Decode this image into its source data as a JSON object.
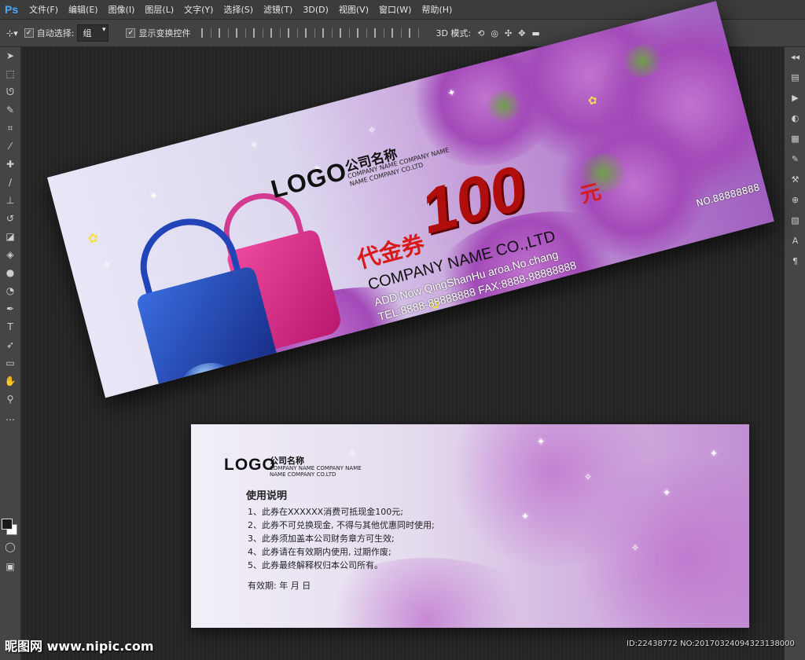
{
  "app": {
    "logo": "Ps"
  },
  "menu": [
    "文件(F)",
    "编辑(E)",
    "图像(I)",
    "图层(L)",
    "文字(Y)",
    "选择(S)",
    "滤镜(T)",
    "3D(D)",
    "视图(V)",
    "窗口(W)",
    "帮助(H)"
  ],
  "options": {
    "auto_select_label": "自动选择:",
    "auto_select_value": "组",
    "show_transform_label": "显示变换控件",
    "mode_3d_label": "3D 模式:"
  },
  "tools": [
    "move-tool",
    "marquee-tool",
    "lasso-tool",
    "quick-select-tool",
    "crop-tool",
    "eyedropper-tool",
    "healing-tool",
    "brush-tool",
    "clone-stamp-tool",
    "history-brush-tool",
    "eraser-tool",
    "paint-bucket-tool",
    "blur-tool",
    "dodge-tool",
    "pen-tool",
    "type-tool",
    "path-select-tool",
    "rectangle-tool",
    "hand-tool",
    "zoom-tool"
  ],
  "panels": [
    "play-icon",
    "adjust-icon",
    "brush-panel-icon",
    "paragraph-icon",
    "character-icon"
  ],
  "voucher_front": {
    "logo": "LOGO",
    "company_cn": "公司名称",
    "company_line1": "COMPANY NAME COMPANY NAME",
    "company_line2": "NAME COMPANY CO.LTD",
    "voucher_label": "代金券",
    "amount": "100",
    "currency": "元",
    "company_en": "COMPANY NAME CO.,LTD",
    "address": "ADD:Now QingShanHu aroa.No.chang",
    "tel_fax": "TEL:8888-88888888  FAX:8888-88888888",
    "serial": "NO.88888888"
  },
  "voucher_back": {
    "logo": "LOGO",
    "company_cn": "公司名称",
    "company_line1": "COMPANY NAME COMPANY NAME",
    "company_line2": "NAME COMPANY CO.LTD",
    "instructions_title": "使用说明",
    "rules": [
      "1、此券在XXXXXX消费可抵现金100元;",
      "2、此券不可兑换现金, 不得与其他优惠同时使用;",
      "3、此券须加盖本公司财务章方可生效;",
      "4、此券请在有效期内使用, 过期作废;",
      "5、此券最终解释权归本公司所有。"
    ],
    "validity": "有效期:        年    月    日"
  },
  "footer": {
    "watermark": "昵图网 www.nipic.com",
    "id_text": "ID:22438772 NO:20170324094323138000"
  }
}
